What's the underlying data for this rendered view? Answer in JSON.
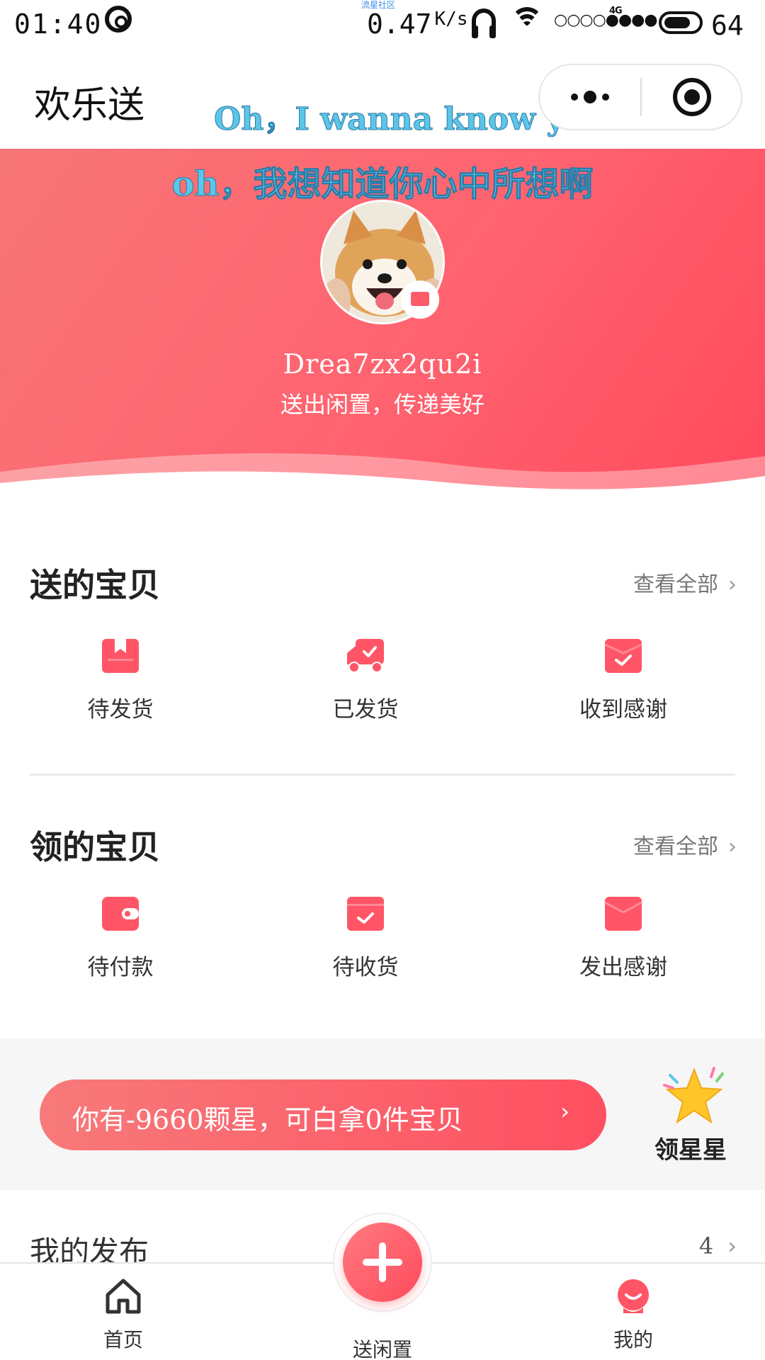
{
  "status_bar": {
    "time": "01:40",
    "net_caption": "流星社区",
    "net_speed": "0.47",
    "net_speed_unit": "K/s",
    "network_type": "4G",
    "battery_level": "64"
  },
  "nav": {
    "title": "欢乐送"
  },
  "lyrics": {
    "line1": "Oh，I wanna know ya",
    "line2": "oh，我想知道你心中所想啊"
  },
  "profile": {
    "username": "Drea7zx2qu2i",
    "slogan": "送出闲置，传递美好"
  },
  "given_section": {
    "title": "送的宝贝",
    "view_all": "查看全部",
    "items": [
      {
        "label": "待发货",
        "icon": "package-icon"
      },
      {
        "label": "已发货",
        "icon": "truck-icon"
      },
      {
        "label": "收到感谢",
        "icon": "thanks-envelope-icon"
      }
    ]
  },
  "received_section": {
    "title": "领的宝贝",
    "view_all": "查看全部",
    "items": [
      {
        "label": "待付款",
        "icon": "wallet-icon"
      },
      {
        "label": "待收货",
        "icon": "receive-box-icon"
      },
      {
        "label": "发出感谢",
        "icon": "send-envelope-icon"
      }
    ]
  },
  "stars": {
    "message": "你有-9660颗星，可白拿0件宝贝",
    "arrow": "›",
    "get_label": "领星星"
  },
  "my_posts": {
    "title": "我的发布",
    "count": "4"
  },
  "tab_bar": {
    "home": "首页",
    "post": "送闲置",
    "mine": "我的"
  },
  "colors": {
    "accent": "#ff5566",
    "lyric": "#5cc6e8"
  }
}
